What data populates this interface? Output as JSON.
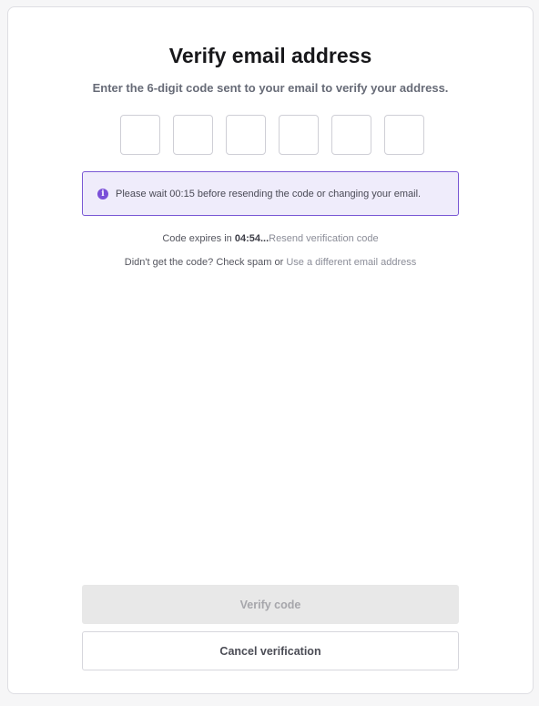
{
  "header": {
    "title": "Verify email address",
    "subtitle": "Enter the 6-digit code sent to your email to verify your address."
  },
  "otp": {
    "digits": [
      "",
      "",
      "",
      "",
      "",
      ""
    ]
  },
  "alert": {
    "icon": "info-icon",
    "icon_glyph": "i",
    "message": "Please wait 00:15 before resending the code or changing your email.",
    "accent": "#7a4fd8",
    "background": "#efecfb"
  },
  "expiry": {
    "prefix": "Code expires in ",
    "countdown": "04:54...",
    "resend_label": "Resend verification code"
  },
  "spam": {
    "prefix": "Didn't get the code? Check spam or ",
    "change_email_label": "Use a different email address"
  },
  "actions": {
    "verify_label": "Verify code",
    "cancel_label": "Cancel verification"
  }
}
